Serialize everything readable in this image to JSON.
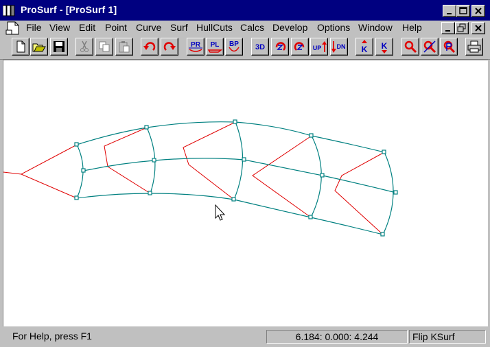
{
  "window": {
    "title": "ProSurf - [ProSurf 1]",
    "controls": {
      "minimize": "_",
      "maximize": "□",
      "close": "×",
      "child_restore": "⧉"
    }
  },
  "menu": [
    "File",
    "View",
    "Edit",
    "Point",
    "Curve",
    "Surf",
    "HullCuts",
    "Calcs",
    "Develop",
    "Options",
    "Window",
    "Help"
  ],
  "toolbar": {
    "pr": "PR",
    "pl": "PL",
    "bp": "BP",
    "td": "3D",
    "up": "UP",
    "dn": "DN",
    "k": "K"
  },
  "status": {
    "help": "For Help, press F1",
    "coords": "6.184:  0.000:  4.244",
    "mode": "Flip KSurf"
  },
  "colors": {
    "surface": "#008080",
    "net": "#e00000",
    "titlebar": "#000080"
  }
}
